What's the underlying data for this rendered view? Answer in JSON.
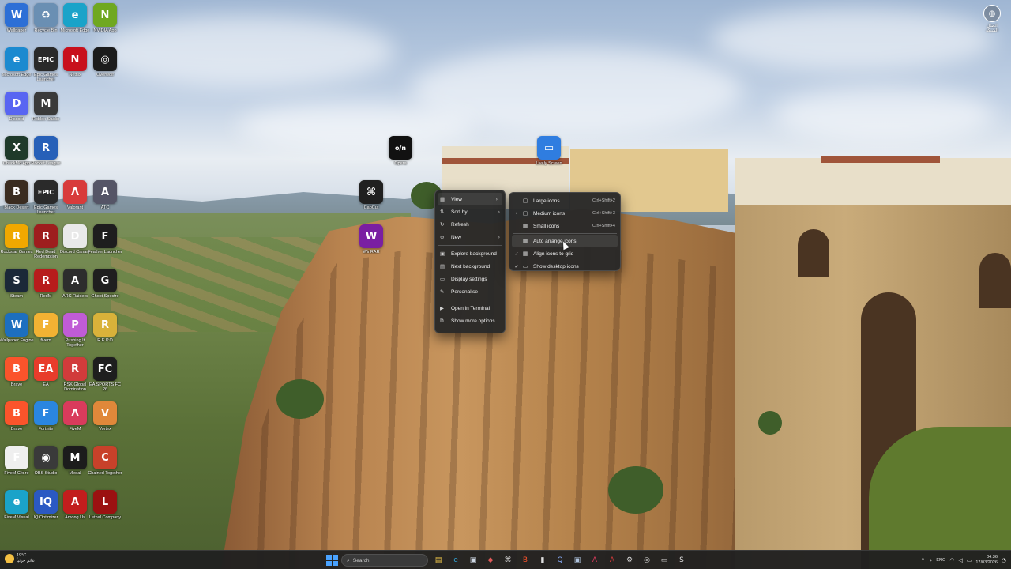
{
  "desktop": {
    "icons": [
      {
        "label": "Wallpaper",
        "glyph": "W",
        "color": "#2c6fd6"
      },
      {
        "label": "Recycle Bin",
        "glyph": "♻",
        "color": "#6a8fb3"
      },
      {
        "label": "Microsoft Edge",
        "glyph": "e",
        "color": "#1aa3c9"
      },
      {
        "label": "NVIDIA App",
        "glyph": "N",
        "color": "#6fa820"
      },
      {
        "label": "Microsoft Edge",
        "glyph": "e",
        "color": "#1b8ad0"
      },
      {
        "label": "Epic Games Launcher",
        "glyph": "EPIC",
        "color": "#2a2a2a"
      },
      {
        "label": "Netflix",
        "glyph": "N",
        "color": "#c8101c"
      },
      {
        "label": "Overwolf",
        "glyph": "◎",
        "color": "#1c1c1c"
      },
      {
        "label": "Discord",
        "glyph": "D",
        "color": "#5865f2"
      },
      {
        "label": "Roblox Studio",
        "glyph": "M",
        "color": "#3a3a3a"
      },
      {
        "label": "CheckM8 App",
        "glyph": "X",
        "color": "#1f3a2a"
      },
      {
        "label": "Rocket League",
        "glyph": "R",
        "color": "#2760b8"
      },
      {
        "label": "Black Desert",
        "glyph": "B",
        "color": "#3a2c20"
      },
      {
        "label": "Epic Games Launcher",
        "glyph": "EPIC",
        "color": "#2a2a2a"
      },
      {
        "label": "Valorant",
        "glyph": "Λ",
        "color": "#d83b3b"
      },
      {
        "label": "ATC",
        "glyph": "A",
        "color": "#556"
      },
      {
        "label": "Rockstar Games",
        "glyph": "R",
        "color": "#f0a800"
      },
      {
        "label": "Red Dead Redemption",
        "glyph": "R",
        "color": "#9e1e1e"
      },
      {
        "label": "Discord Canary",
        "glyph": "D",
        "color": "#e9e9e9"
      },
      {
        "label": "Feather Launcher",
        "glyph": "F",
        "color": "#1e1e1e"
      },
      {
        "label": "Steam",
        "glyph": "S",
        "color": "#1b2838"
      },
      {
        "label": "RedM",
        "glyph": "R",
        "color": "#b71c1c"
      },
      {
        "label": "ARC Raiders",
        "glyph": "A",
        "color": "#2d2d2d"
      },
      {
        "label": "Ghost Spectre",
        "glyph": "G",
        "color": "#1f1f1f"
      },
      {
        "label": "Wallpaper Engine",
        "glyph": "W",
        "color": "#1d6fbf"
      },
      {
        "label": "fivem",
        "glyph": "F",
        "color": "#f2b233"
      },
      {
        "label": "Pushing It Together",
        "glyph": "P",
        "color": "#c05cd6"
      },
      {
        "label": "R.E.P.O",
        "glyph": "R",
        "color": "#d9b23a"
      },
      {
        "label": "Brave",
        "glyph": "B",
        "color": "#fb542b"
      },
      {
        "label": "EA",
        "glyph": "EA",
        "color": "#e83c2b"
      },
      {
        "label": "RSK Global Domination",
        "glyph": "R",
        "color": "#d13b3b"
      },
      {
        "label": "EA SPORTS FC 26",
        "glyph": "FC",
        "color": "#1e1e1e"
      },
      {
        "label": "Brave",
        "glyph": "B",
        "color": "#fb542b"
      },
      {
        "label": "Fortnite",
        "glyph": "F",
        "color": "#2a86e0"
      },
      {
        "label": "FiveM",
        "glyph": "Λ",
        "color": "#d93b5c"
      },
      {
        "label": "Vortex",
        "glyph": "V",
        "color": "#e0883a"
      },
      {
        "label": "FiveM Cfx.re",
        "glyph": "F",
        "color": "#efefef"
      },
      {
        "label": "OBS Studio",
        "glyph": "◉",
        "color": "#3a3a3a"
      },
      {
        "label": "Medal",
        "glyph": "M",
        "color": "#1c1c1c"
      },
      {
        "label": "Chained Together",
        "glyph": "C",
        "color": "#c8412a"
      },
      {
        "label": "FiveM Visual",
        "glyph": "e",
        "color": "#1aa3c9"
      },
      {
        "label": "IQ Optimizer",
        "glyph": "IQ",
        "color": "#2b59c3"
      },
      {
        "label": "Among Us",
        "glyph": "A",
        "color": "#c21d1d"
      },
      {
        "label": "Lethal Company",
        "glyph": "L",
        "color": "#9b1111"
      },
      {
        "label": "CapCut",
        "glyph": "⌘",
        "color": "#202020"
      },
      {
        "label": "WinRAR",
        "glyph": "W",
        "color": "#7a1fa2"
      },
      {
        "label": "Opera",
        "glyph": "o/n",
        "color": "#111"
      },
      {
        "label": "Lively Screen",
        "glyph": "▭",
        "color": "#2f7de0"
      }
    ]
  },
  "context_menu": {
    "items": [
      {
        "icon": "▦",
        "label": "View",
        "arrow": "›"
      },
      {
        "icon": "⇅",
        "label": "Sort by",
        "arrow": "›"
      },
      {
        "icon": "↻",
        "label": "Refresh",
        "arrow": ""
      },
      {
        "icon": "⊕",
        "label": "New",
        "arrow": "›"
      },
      {
        "icon": "▣",
        "label": "Explore background",
        "arrow": ""
      },
      {
        "icon": "▤",
        "label": "Next background",
        "arrow": ""
      },
      {
        "icon": "▭",
        "label": "Display settings",
        "arrow": ""
      },
      {
        "icon": "✎",
        "label": "Personalise",
        "arrow": ""
      },
      {
        "icon": "▶",
        "label": "Open in Terminal",
        "arrow": ""
      },
      {
        "icon": "⧉",
        "label": "Show more options",
        "arrow": ""
      }
    ]
  },
  "view_submenu": {
    "items": [
      {
        "mark": "",
        "icon": "▢",
        "label": "Large icons",
        "shortcut": "Ctrl+Shift+2"
      },
      {
        "mark": "•",
        "icon": "▢",
        "label": "Medium icons",
        "shortcut": "Ctrl+Shift+3"
      },
      {
        "mark": "",
        "icon": "▦",
        "label": "Small icons",
        "shortcut": "Ctrl+Shift+4"
      },
      {
        "mark": "",
        "icon": "▦",
        "label": "Auto arrange icons",
        "shortcut": ""
      },
      {
        "mark": "✓",
        "icon": "▦",
        "label": "Align icons to grid",
        "shortcut": ""
      },
      {
        "mark": "✓",
        "icon": "▭",
        "label": "Show desktop icons",
        "shortcut": ""
      }
    ]
  },
  "taskbar": {
    "weather_temp": "19°C",
    "weather_desc": "غائم جزئياً",
    "search_placeholder": "Search",
    "language": "ENG",
    "time": "04:36",
    "date": "17/03/2026",
    "apps": [
      {
        "icon": "folder-icon",
        "glyph": "▤",
        "color": "#f3c94a"
      },
      {
        "icon": "edge-icon",
        "glyph": "e",
        "color": "#32a9e0"
      },
      {
        "icon": "store-icon",
        "glyph": "▣",
        "color": "#cfd8e3"
      },
      {
        "icon": "app-icon",
        "glyph": "◆",
        "color": "#e05a5a"
      },
      {
        "icon": "capcut-icon",
        "glyph": "⌘",
        "color": "#ddd"
      },
      {
        "icon": "brave-icon",
        "glyph": "B",
        "color": "#fb542b"
      },
      {
        "icon": "app-icon",
        "glyph": "▮",
        "color": "#e0e0e0"
      },
      {
        "icon": "iq-icon",
        "glyph": "Q",
        "color": "#8bb0ff"
      },
      {
        "icon": "terminal-icon",
        "glyph": "▣",
        "color": "#b0c4de"
      },
      {
        "icon": "fivem-icon",
        "glyph": "Λ",
        "color": "#d93b5c"
      },
      {
        "icon": "app-icon",
        "glyph": "A",
        "color": "#d83b3b"
      },
      {
        "icon": "settings-icon",
        "glyph": "⚙",
        "color": "#ddd"
      },
      {
        "icon": "app-icon",
        "glyph": "◎",
        "color": "#ddd"
      },
      {
        "icon": "app-icon",
        "glyph": "▭",
        "color": "#ddd"
      },
      {
        "icon": "steam-icon",
        "glyph": "S",
        "color": "#e0e0e0"
      }
    ]
  },
  "corner_widget": {
    "label": "اتصال الشبكة"
  }
}
